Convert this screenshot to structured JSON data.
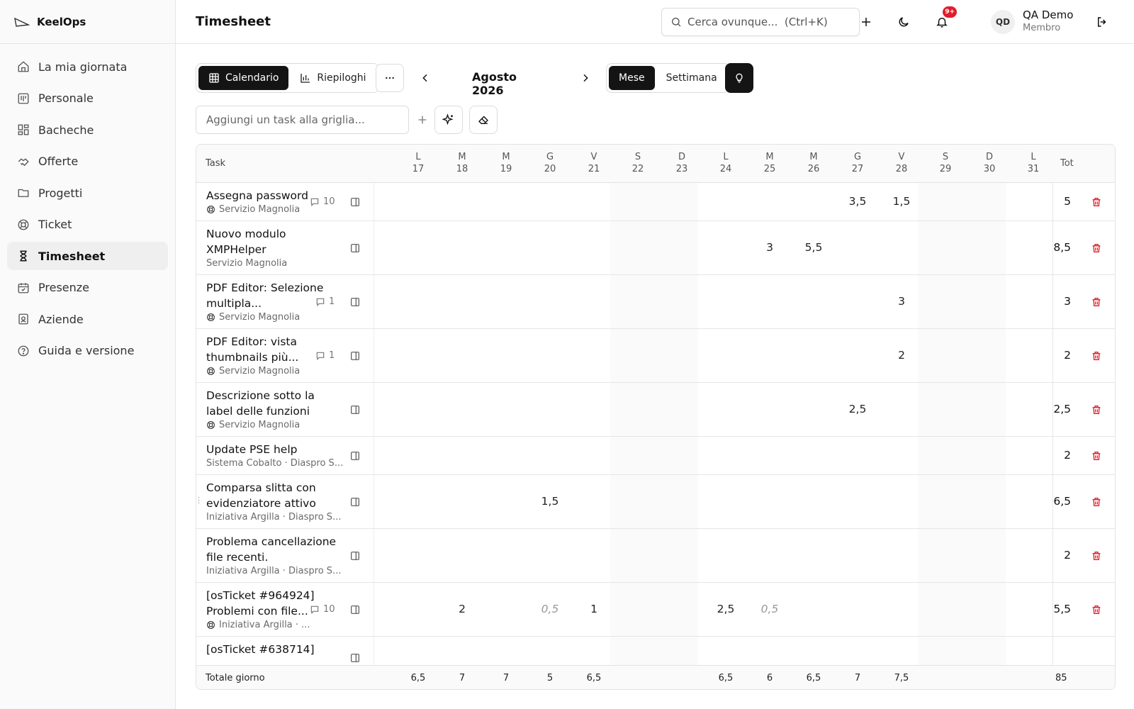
{
  "brand": {
    "name": "KeelOps"
  },
  "sidebar": {
    "items": [
      {
        "label": "La mia giornata",
        "icon": "home-icon",
        "active": false
      },
      {
        "label": "Personale",
        "icon": "kanban-icon",
        "active": false
      },
      {
        "label": "Bacheche",
        "icon": "boards-icon",
        "active": false
      },
      {
        "label": "Offerte",
        "icon": "handshake-icon",
        "active": false
      },
      {
        "label": "Progetti",
        "icon": "folder-icon",
        "active": false
      },
      {
        "label": "Ticket",
        "icon": "lifebuoy-icon",
        "active": false
      },
      {
        "label": "Timesheet",
        "icon": "hourglass-icon",
        "active": true
      },
      {
        "label": "Presenze",
        "icon": "calendar-check-icon",
        "active": false
      },
      {
        "label": "Aziende",
        "icon": "badge-icon",
        "active": false
      },
      {
        "label": "Guida e versione",
        "icon": "help-circle-icon",
        "active": false
      }
    ]
  },
  "header": {
    "title": "Timesheet",
    "search_placeholder": "Cerca ovunque...  (Ctrl+K)",
    "notifications_badge": "9+",
    "user_initials": "QD",
    "user_name": "QA Demo",
    "user_role": "Membro"
  },
  "toolbar": {
    "view_calendar": "Calendario",
    "view_summary": "Riepiloghi",
    "month": "Agosto 2026",
    "mode_month": "Mese",
    "mode_week": "Settimana",
    "task_placeholder": "Aggiungi un task alla griglia..."
  },
  "grid": {
    "task_header": "Task",
    "total_header": "Tot",
    "days": [
      {
        "dow": "L",
        "num": "17"
      },
      {
        "dow": "M",
        "num": "18"
      },
      {
        "dow": "M",
        "num": "19"
      },
      {
        "dow": "G",
        "num": "20"
      },
      {
        "dow": "V",
        "num": "21"
      },
      {
        "dow": "S",
        "num": "22"
      },
      {
        "dow": "D",
        "num": "23"
      },
      {
        "dow": "L",
        "num": "24"
      },
      {
        "dow": "M",
        "num": "25"
      },
      {
        "dow": "M",
        "num": "26"
      },
      {
        "dow": "G",
        "num": "27"
      },
      {
        "dow": "V",
        "num": "28"
      },
      {
        "dow": "S",
        "num": "29"
      },
      {
        "dow": "D",
        "num": "30"
      },
      {
        "dow": "L",
        "num": "31"
      }
    ],
    "rows": [
      {
        "title": "Assegna password",
        "sub": "Servizio Magnolia",
        "sub_icon": true,
        "comments": "10",
        "total": "5",
        "values": [
          "",
          "",
          "",
          "",
          "",
          "",
          "",
          "",
          "",
          "",
          "3,5",
          "1,5",
          "",
          "",
          ""
        ]
      },
      {
        "title": "Nuovo modulo XMPHelper",
        "sub": "Servizio Magnolia",
        "sub_icon": false,
        "comments": "",
        "total": "8,5",
        "values": [
          "",
          "",
          "",
          "",
          "",
          "",
          "",
          "",
          "3",
          "5,5",
          "",
          "",
          "",
          "",
          ""
        ]
      },
      {
        "title": "PDF Editor: Selezione multipla...",
        "sub": "Servizio Magnolia",
        "sub_icon": true,
        "comments": "1",
        "total": "3",
        "values": [
          "",
          "",
          "",
          "",
          "",
          "",
          "",
          "",
          "",
          "",
          "",
          "3",
          "",
          "",
          ""
        ]
      },
      {
        "title": "PDF Editor: vista thumbnails più...",
        "sub": "Servizio Magnolia",
        "sub_icon": true,
        "comments": "1",
        "total": "2",
        "values": [
          "",
          "",
          "",
          "",
          "",
          "",
          "",
          "",
          "",
          "",
          "",
          "2",
          "",
          "",
          ""
        ]
      },
      {
        "title": "Descrizione sotto la label delle funzioni",
        "sub": "Servizio Magnolia",
        "sub_icon": true,
        "comments": "",
        "total": "2,5",
        "values": [
          "",
          "",
          "",
          "",
          "",
          "",
          "",
          "",
          "",
          "",
          "2,5",
          "",
          "",
          "",
          ""
        ]
      },
      {
        "title": "Update PSE help",
        "sub": "Sistema Cobalto · Diaspro S...",
        "sub_icon": false,
        "comments": "",
        "total": "2",
        "values": [
          "",
          "",
          "",
          "",
          "",
          "",
          "",
          "",
          "",
          "",
          "",
          "",
          "",
          "",
          ""
        ]
      },
      {
        "title": "Comparsa slitta con evidenziatore attivo",
        "sub": "Iniziativa Argilla · Diaspro S...",
        "sub_icon": false,
        "comments": "",
        "total": "6,5",
        "values": [
          "",
          "",
          "",
          "1,5",
          "",
          "",
          "",
          "",
          "",
          "",
          "",
          "",
          "",
          "",
          ""
        ]
      },
      {
        "title": "Problema cancellazione file recenti.",
        "sub": "Iniziativa Argilla · Diaspro S...",
        "sub_icon": false,
        "comments": "",
        "total": "2",
        "values": [
          "",
          "",
          "",
          "",
          "",
          "",
          "",
          "",
          "",
          "",
          "",
          "",
          "",
          "",
          ""
        ]
      },
      {
        "title": "[osTicket #964924] Problemi con file...",
        "sub": "Iniziativa Argilla · ...",
        "sub_icon": true,
        "comments": "10",
        "total": "5,5",
        "values": [
          "",
          "2",
          "",
          "0,5",
          "1",
          "",
          "",
          "2,5",
          "0,5",
          "",
          "",
          "",
          "",
          "",
          ""
        ],
        "muted": [
          3,
          8
        ]
      },
      {
        "title": "[osTicket #638714]",
        "sub": "",
        "sub_icon": false,
        "comments": "",
        "total": "",
        "values": [
          "",
          "",
          "",
          "",
          "",
          "",
          "",
          "",
          "",
          "",
          "",
          "",
          "",
          "",
          ""
        ]
      }
    ],
    "footer_label": "Totale giorno",
    "footer_values": [
      "6,5",
      "7",
      "7",
      "5",
      "6,5",
      "",
      "",
      "6,5",
      "6",
      "6,5",
      "7",
      "7,5",
      "",
      "",
      ""
    ],
    "footer_total": "85"
  }
}
